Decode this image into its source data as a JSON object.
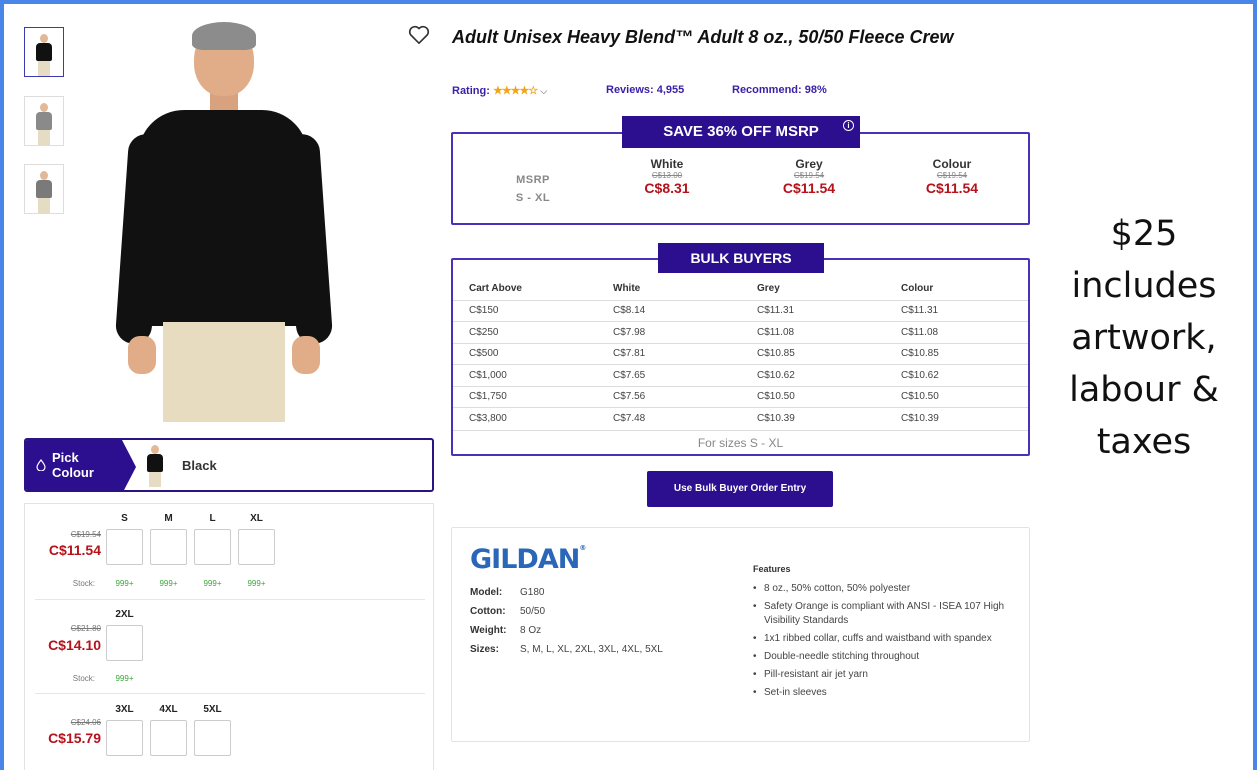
{
  "product": {
    "title": "Adult Unisex Heavy Blend™ Adult 8 oz., 50/50 Fleece Crew",
    "rating_label": "Rating:",
    "rating_stars": "★★★★☆",
    "reviews": "Reviews: 4,955",
    "recommend": "Recommend:  98%"
  },
  "thumbnails": [
    {
      "color": "#111111"
    },
    {
      "color": "#8a8a8a"
    },
    {
      "color": "#7a7a7a"
    }
  ],
  "pick_colour": {
    "label": "Pick Colour",
    "selected": "Black"
  },
  "size_groups": [
    {
      "old_price": "C$19.54",
      "price": "C$11.54",
      "sizes": [
        "S",
        "M",
        "L",
        "XL"
      ],
      "stock_label": "Stock:",
      "stock": [
        "999+",
        "999+",
        "999+",
        "999+"
      ]
    },
    {
      "old_price": "C$21.80",
      "price": "C$14.10",
      "sizes": [
        "2XL"
      ],
      "stock_label": "Stock:",
      "stock": [
        "999+"
      ]
    },
    {
      "old_price": "C$24.06",
      "price": "C$15.79",
      "sizes": [
        "3XL",
        "4XL",
        "5XL"
      ]
    }
  ],
  "msrp": {
    "banner": "SAVE 36% OFF MSRP",
    "info_icon": "i",
    "label_line1": "MSRP",
    "label_line2": "S - XL",
    "columns": [
      {
        "name": "White",
        "old": "C$13.00",
        "price": "C$8.31"
      },
      {
        "name": "Grey",
        "old": "C$19.54",
        "price": "C$11.54"
      },
      {
        "name": "Colour",
        "old": "C$19.54",
        "price": "C$11.54"
      }
    ]
  },
  "bulk": {
    "banner": "BULK BUYERS",
    "headers": [
      "Cart Above",
      "White",
      "Grey",
      "Colour"
    ],
    "rows": [
      [
        "C$150",
        "C$8.14",
        "C$11.31",
        "C$11.31"
      ],
      [
        "C$250",
        "C$7.98",
        "C$11.08",
        "C$11.08"
      ],
      [
        "C$500",
        "C$7.81",
        "C$10.85",
        "C$10.85"
      ],
      [
        "C$1,000",
        "C$7.65",
        "C$10.62",
        "C$10.62"
      ],
      [
        "C$1,750",
        "C$7.56",
        "C$10.50",
        "C$10.50"
      ],
      [
        "C$3,800",
        "C$7.48",
        "C$10.39",
        "C$10.39"
      ]
    ],
    "footer": "For sizes S - XL",
    "button": "Use Bulk Buyer Order Entry"
  },
  "details": {
    "brand": "GILDAN",
    "brand_mark": "®",
    "specs": [
      {
        "label": "Model:",
        "value": "G180"
      },
      {
        "label": "Cotton:",
        "value": "50/50"
      },
      {
        "label": "Weight:",
        "value": "8 Oz"
      },
      {
        "label": "Sizes:",
        "value": "S, M, L, XL, 2XL, 3XL, 4XL, 5XL"
      }
    ],
    "features_title": "Features",
    "features": [
      "8 oz., 50% cotton, 50% polyester",
      "Safety Orange is compliant with ANSI - ISEA 107 High Visibility Standards",
      "1x1 ribbed collar, cuffs and waistband with spandex",
      "Double-needle stitching throughout",
      "Pill-resistant air jet yarn",
      "Set-in sleeves"
    ]
  },
  "promo": {
    "lines": [
      "$25",
      "includes",
      "artwork,",
      "labour &",
      "taxes"
    ]
  },
  "colors": {
    "accent": "#2b0f8f",
    "price_red": "#b5121b",
    "stock_green": "#3aa63a",
    "brand_blue": "#2a67b8",
    "frame_blue": "#4a86e8"
  }
}
